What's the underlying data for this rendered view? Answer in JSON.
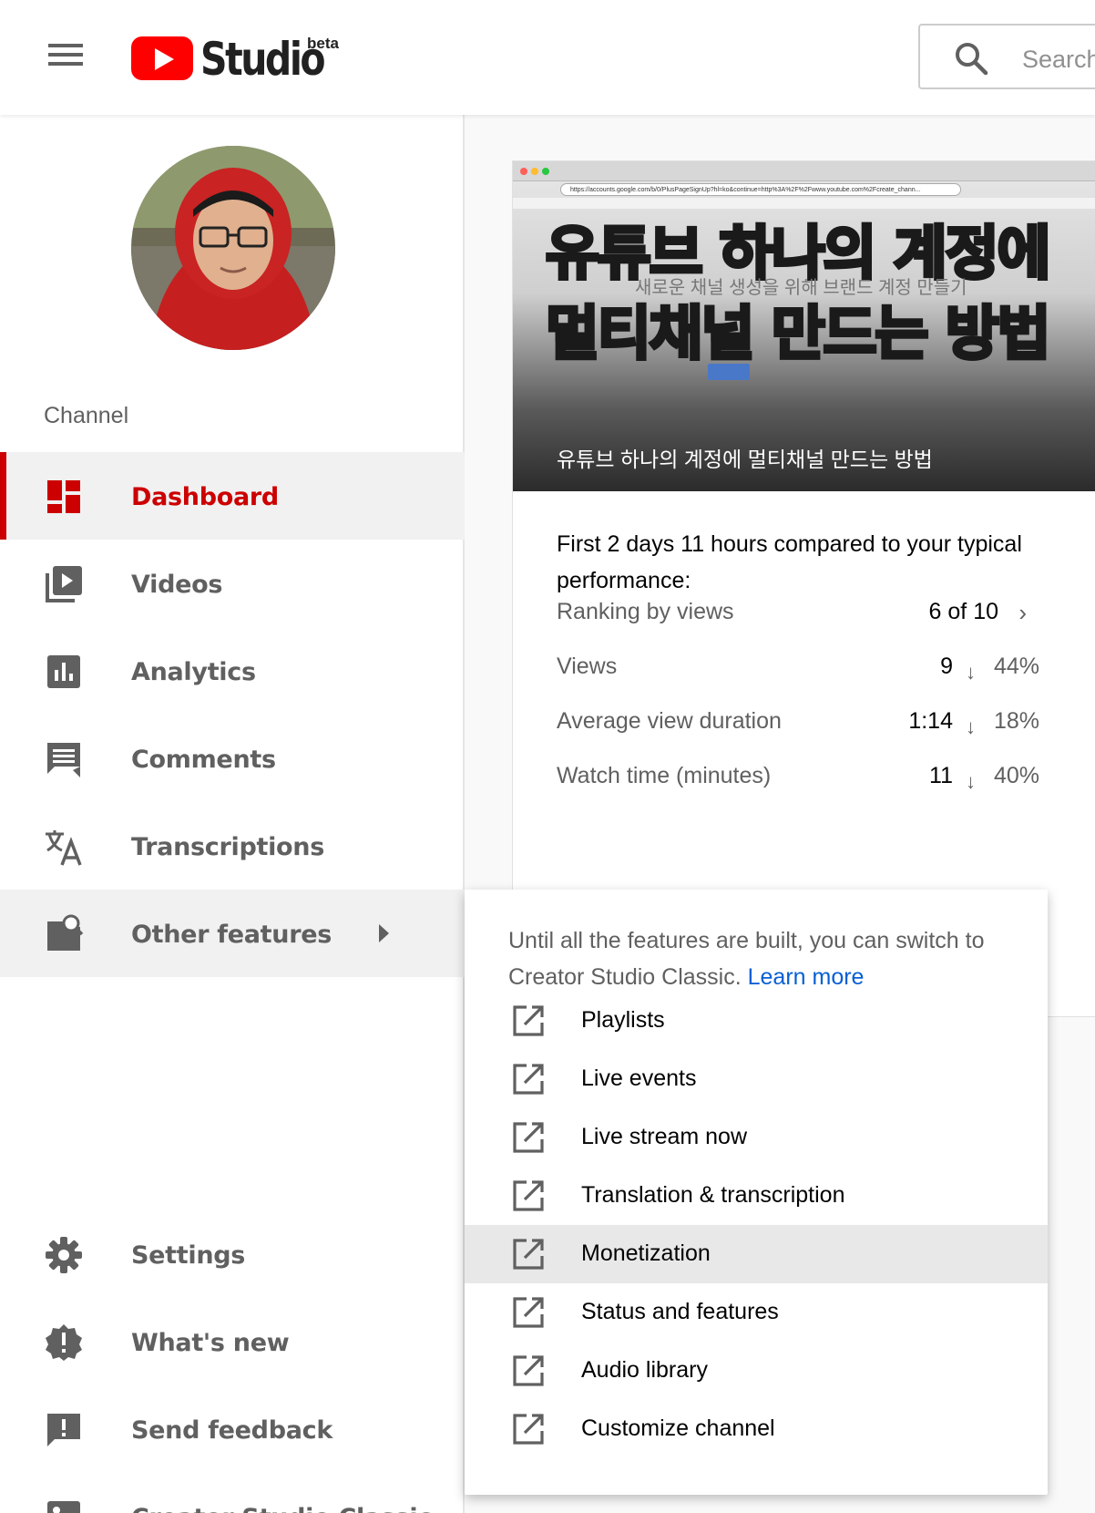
{
  "header": {
    "logo_text": "Studio",
    "beta_label": "beta",
    "search_placeholder": "Search"
  },
  "sidebar": {
    "section_label": "Channel",
    "items": [
      {
        "label": "Dashboard",
        "icon": "dashboard-icon"
      },
      {
        "label": "Videos",
        "icon": "videos-icon"
      },
      {
        "label": "Analytics",
        "icon": "analytics-icon"
      },
      {
        "label": "Comments",
        "icon": "comments-icon"
      },
      {
        "label": "Transcriptions",
        "icon": "transcriptions-icon"
      },
      {
        "label": "Other features",
        "icon": "other-features-icon"
      }
    ],
    "bottom_items": [
      {
        "label": "Settings",
        "icon": "settings-icon"
      },
      {
        "label": "What's new",
        "icon": "whats-new-icon"
      },
      {
        "label": "Send feedback",
        "icon": "feedback-icon"
      },
      {
        "label": "Creator Studio Classic",
        "icon": "classic-icon"
      }
    ]
  },
  "card": {
    "thumbnail": {
      "headline_line1": "유튜브 하나의 계정에",
      "headline_line2": "멀티채널 만드는 방법",
      "subtitle": "새로운 채널 생성을 위해 브랜드 계정 만들기",
      "browser_url": "https://accounts.google.com/b/0/PlusPageSignUp?hl=ko&continue=http%3A%2F%2Fwww.youtube.com%2Fcreate_chann..."
    },
    "video_title": "유튜브 하나의 계정에 멀티채널 만드는 방법",
    "performance_heading": "First 2 days 11 hours compared to your typical performance:",
    "ranking": {
      "label": "Ranking by views",
      "value": "6 of 10"
    },
    "metrics": [
      {
        "label": "Views",
        "value": "9",
        "change": "44%",
        "direction": "down"
      },
      {
        "label": "Average view duration",
        "value": "1:14",
        "change": "18%",
        "direction": "down"
      },
      {
        "label": "Watch time (minutes)",
        "value": "11",
        "change": "40%",
        "direction": "down"
      }
    ]
  },
  "dropdown": {
    "note": "Until all the features are built, you can switch to Creator Studio Classic.",
    "learn_more": "Learn more",
    "items": [
      {
        "label": "Playlists"
      },
      {
        "label": "Live events"
      },
      {
        "label": "Live stream now"
      },
      {
        "label": "Translation & transcription"
      },
      {
        "label": "Monetization"
      },
      {
        "label": "Status and features"
      },
      {
        "label": "Audio library"
      },
      {
        "label": "Customize channel"
      }
    ]
  },
  "colors": {
    "brand_red": "#ff0000",
    "active_red": "#cc0000",
    "link_blue": "#065fd4",
    "thumb_yellow": "#ffd400",
    "thumb_blue": "#1d4ec7"
  }
}
